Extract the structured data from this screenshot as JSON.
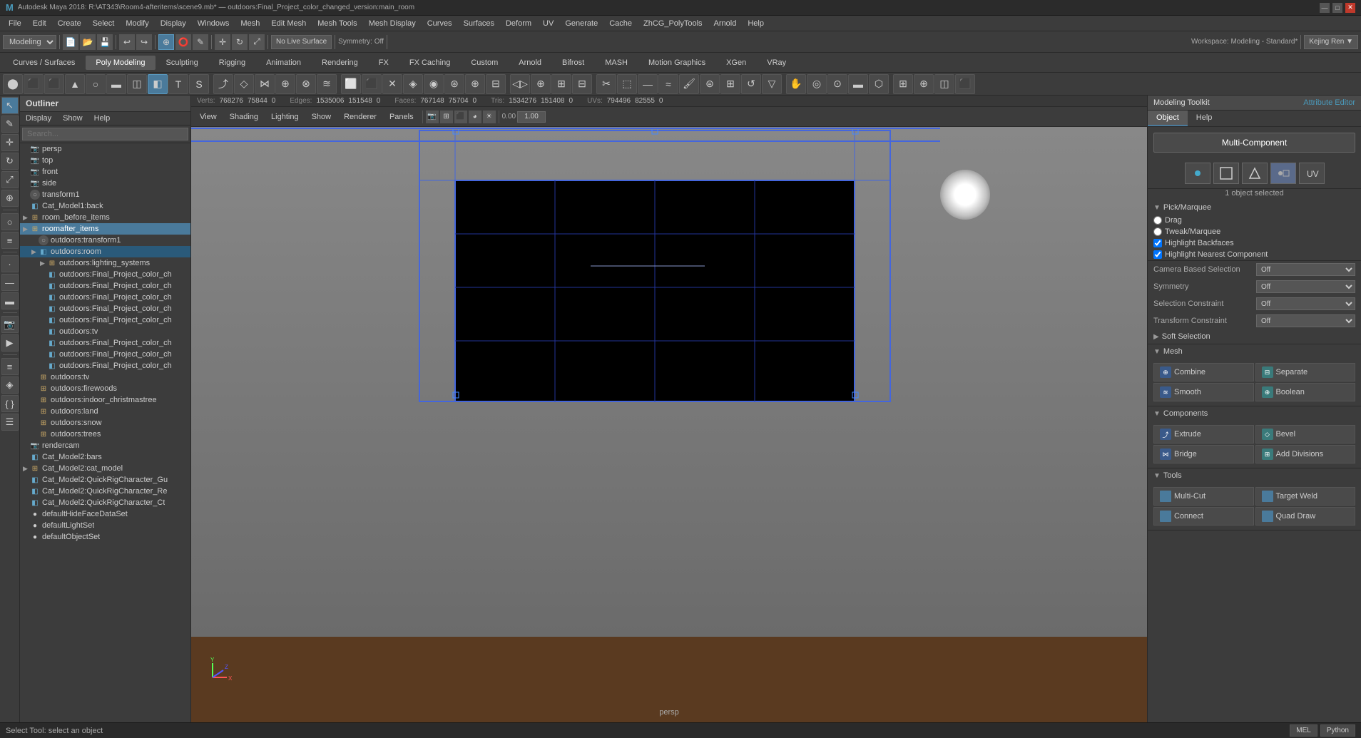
{
  "titlebar": {
    "title": "Autodesk Maya 2018: R:\\AT343\\Room4-afteritems\\scene9.mb* — outdoors:Final_Project_color_changed_version:main_room",
    "minimize": "—",
    "maximize": "□",
    "close": "✕"
  },
  "menubar": {
    "items": [
      "File",
      "Edit",
      "Create",
      "Select",
      "Modify",
      "Display",
      "Windows",
      "Mesh",
      "Edit Mesh",
      "Mesh Tools",
      "Mesh Display",
      "Curves",
      "Surfaces",
      "Deform",
      "UV",
      "Generate",
      "Cache",
      "ZhCG_PolyTools",
      "Arnold",
      "Help"
    ]
  },
  "toolbar1": {
    "workspace_label": "Workspace:",
    "workspace_value": "Modeling - Standard*",
    "mode": "Modeling"
  },
  "mode_tabs": {
    "tabs": [
      "Curves / Surfaces",
      "Poly Modeling",
      "Sculpting",
      "Rigging",
      "Animation",
      "Rendering",
      "FX",
      "FX Caching",
      "Custom",
      "Arnold",
      "Bifrost",
      "MASH",
      "Motion Graphics",
      "XGen",
      "VRay"
    ]
  },
  "outliner": {
    "title": "Outliner",
    "menu_items": [
      "Display",
      "Show",
      "Help"
    ],
    "search_placeholder": "Search...",
    "items": [
      {
        "label": "persp",
        "indent": 1,
        "icon": "camera",
        "arrow": false
      },
      {
        "label": "top",
        "indent": 1,
        "icon": "camera",
        "arrow": false
      },
      {
        "label": "front",
        "indent": 1,
        "icon": "camera",
        "arrow": false
      },
      {
        "label": "side",
        "indent": 1,
        "icon": "camera",
        "arrow": false
      },
      {
        "label": "transform1",
        "indent": 1,
        "icon": "transform",
        "arrow": false
      },
      {
        "label": "Cat_Model1:back",
        "indent": 1,
        "icon": "mesh",
        "arrow": false
      },
      {
        "label": "room_before_items",
        "indent": 1,
        "icon": "group",
        "arrow": true
      },
      {
        "label": "roomafter_items",
        "indent": 1,
        "icon": "group",
        "arrow": true,
        "selected": true
      },
      {
        "label": "outdoors:transform1",
        "indent": 2,
        "icon": "transform",
        "arrow": false
      },
      {
        "label": "outdoors:room",
        "indent": 2,
        "icon": "mesh",
        "arrow": true,
        "highlight": true
      },
      {
        "label": "outdoors:lighting_systems",
        "indent": 3,
        "icon": "group",
        "arrow": true
      },
      {
        "label": "outdoors:Final_Project_color_ch",
        "indent": 3,
        "icon": "mesh",
        "arrow": false
      },
      {
        "label": "outdoors:Final_Project_color_ch",
        "indent": 3,
        "icon": "mesh",
        "arrow": false
      },
      {
        "label": "outdoors:Final_Project_color_ch",
        "indent": 3,
        "icon": "mesh",
        "arrow": false
      },
      {
        "label": "outdoors:Final_Project_color_ch",
        "indent": 3,
        "icon": "mesh",
        "arrow": false
      },
      {
        "label": "outdoors:Final_Project_color_ch",
        "indent": 3,
        "icon": "mesh",
        "arrow": false
      },
      {
        "label": "outdoors:tv",
        "indent": 3,
        "icon": "mesh",
        "arrow": false
      },
      {
        "label": "outdoors:Final_Project_color_ch",
        "indent": 3,
        "icon": "mesh",
        "arrow": false
      },
      {
        "label": "outdoors:Final_Project_color_ch",
        "indent": 3,
        "icon": "mesh",
        "arrow": false
      },
      {
        "label": "outdoors:Final_Project_color_ch",
        "indent": 3,
        "icon": "mesh",
        "arrow": false
      },
      {
        "label": "outdoors:tv",
        "indent": 2,
        "icon": "group",
        "arrow": false
      },
      {
        "label": "outdoors:firewoods",
        "indent": 2,
        "icon": "group",
        "arrow": false
      },
      {
        "label": "outdoors:indoor_christmastree",
        "indent": 2,
        "icon": "group",
        "arrow": false
      },
      {
        "label": "outdoors:land",
        "indent": 2,
        "icon": "group",
        "arrow": false
      },
      {
        "label": "outdoors:snow",
        "indent": 2,
        "icon": "group",
        "arrow": false
      },
      {
        "label": "outdoors:trees",
        "indent": 2,
        "icon": "group",
        "arrow": false
      },
      {
        "label": "rendercam",
        "indent": 1,
        "icon": "camera",
        "arrow": false
      },
      {
        "label": "Cat_Model2:bars",
        "indent": 1,
        "icon": "mesh",
        "arrow": false
      },
      {
        "label": "Cat_Model2:cat_model",
        "indent": 1,
        "icon": "group",
        "arrow": true
      },
      {
        "label": "Cat_Model2:QuickRigCharacter_Gu",
        "indent": 1,
        "icon": "mesh",
        "arrow": false
      },
      {
        "label": "Cat_Model2:QuickRigCharacter_Re",
        "indent": 1,
        "icon": "mesh",
        "arrow": false
      },
      {
        "label": "Cat_Model2:QuickRigCharacter_Ct",
        "indent": 1,
        "icon": "mesh",
        "arrow": false
      },
      {
        "label": "defaultHideFaceDataSet",
        "indent": 1,
        "icon": "set",
        "arrow": false
      },
      {
        "label": "defaultLightSet",
        "indent": 1,
        "icon": "set",
        "arrow": false
      },
      {
        "label": "defaultObjectSet",
        "indent": 1,
        "icon": "set",
        "arrow": false
      }
    ]
  },
  "stats": {
    "verts_label": "Verts:",
    "verts_val1": "768276",
    "verts_val2": "75844",
    "verts_val3": "0",
    "edges_label": "Edges:",
    "edges_val1": "1535006",
    "edges_val2": "151548",
    "edges_val3": "0",
    "faces_label": "Faces:",
    "faces_val1": "767148",
    "faces_val2": "75704",
    "faces_val3": "0",
    "tris_label": "Tris:",
    "tris_val1": "1534276",
    "tris_val2": "151408",
    "tris_val3": "0",
    "uvs_label": "UVs:",
    "uvs_val1": "794496",
    "uvs_val2": "82555",
    "uvs_val3": "0"
  },
  "viewport": {
    "menus": [
      "View",
      "Shading",
      "Lighting",
      "Show",
      "Renderer",
      "Panels"
    ],
    "camera_label": "persp",
    "no_live_surface": "No Live Surface"
  },
  "modeling_toolkit": {
    "title": "Modeling Toolkit",
    "tabs": [
      "Object",
      "Help"
    ],
    "attr_editor": "Attribute Editor",
    "multi_component": "Multi-Component",
    "selected_label": "1 object selected",
    "pick_section": {
      "title": "Pick/Marquee",
      "options": [
        "Drag",
        "Tweak/Marquee"
      ]
    },
    "highlight_backfaces": "Highlight Backfaces",
    "highlight_nearest": "Highlight Nearest Component",
    "camera_based_label": "Camera Based Selection",
    "camera_based_value": "Off",
    "symmetry_label": "Symmetry",
    "symmetry_value": "Off",
    "selection_constraint_label": "Selection Constraint",
    "selection_constraint_value": "Off",
    "transform_constraint_label": "Transform Constraint",
    "transform_constraint_value": "Off",
    "soft_selection": "Soft Selection",
    "mesh_section": {
      "title": "Mesh",
      "buttons": [
        {
          "label": "Combine",
          "icon": "C"
        },
        {
          "label": "Separate",
          "icon": "S"
        },
        {
          "label": "Smooth",
          "icon": "Sm"
        },
        {
          "label": "Boolean",
          "icon": "B"
        }
      ]
    },
    "components_section": {
      "title": "Components",
      "buttons": [
        {
          "label": "Extrude",
          "icon": "E"
        },
        {
          "label": "Bevel",
          "icon": "Bv"
        },
        {
          "label": "Bridge",
          "icon": "Br"
        },
        {
          "label": "Add Divisions",
          "icon": "AD"
        }
      ]
    },
    "tools_section": {
      "title": "Tools",
      "buttons": [
        {
          "label": "Multi-Cut",
          "icon": "MC"
        },
        {
          "label": "Target Weld",
          "icon": "TW"
        },
        {
          "label": "Connect",
          "icon": "Co"
        },
        {
          "label": "Quad Draw",
          "icon": "QD"
        }
      ]
    }
  },
  "status_bar": {
    "message": "Select Tool: select an object",
    "mel_btn": "MEL",
    "python_btn": "Python"
  }
}
